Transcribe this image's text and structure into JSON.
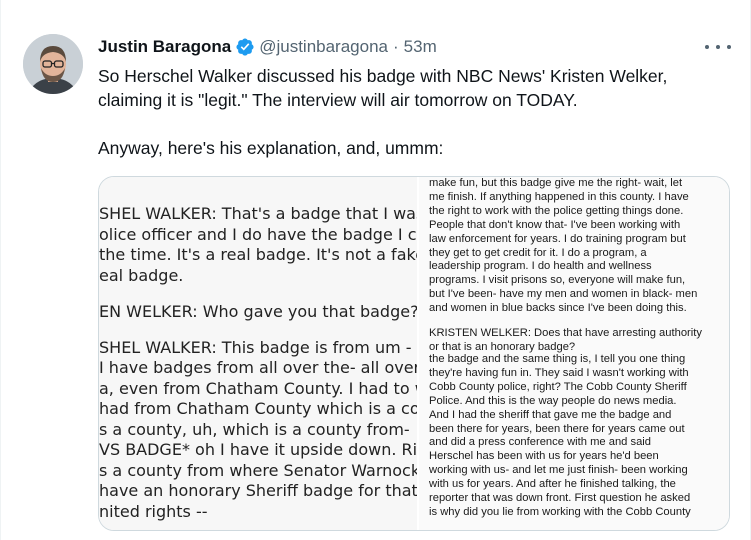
{
  "author": {
    "display_name": "Justin Baragona",
    "handle": "@justinbaragona",
    "separator": "·",
    "time": "53m"
  },
  "tweet": {
    "paragraph1": "So Herschel Walker discussed his badge with NBC News' Kristen Welker, claiming it is \"legit.\" The interview will air tomorrow on TODAY.",
    "paragraph2": "Anyway, here's his explanation, and, ummm:"
  },
  "media": {
    "left_transcript": [
      "SHEL WALKER: That's a badge that I was g",
      "olice officer and I do have the badge I carr",
      "the time. It's a real badge. It's not a fake b",
      "eal badge.",
      "EN WELKER: Who gave you that badge?",
      "SHEL WALKER: This badge is from um - th",
      "I have badges from all over the- all over",
      "a, even from Chatham County. I had to wa",
      "had from Chatham County which is a cou",
      "s a county, uh, which is a county from-",
      "VS BADGE* oh I have it upside down. Righ",
      "s a county from where Senator Warnock",
      "have an honorary Sheriff badge for that c",
      "nited rights --"
    ],
    "right_top": [
      "make fun, but this badge give me the right- wait, let",
      "me finish. If anything happened in this county. I have",
      "the right to work with the police getting things done.",
      "People that don't know that- I've been working with",
      "law enforcement for years. I do training program but",
      "they get to get credit for it. I do a program, a",
      "leadership program. I do health and wellness",
      "programs. I visit prisons so, everyone will make fun,",
      "but I've been- have my men and women in black- men",
      "and women in blue backs since I've been doing this."
    ],
    "right_question": [
      "KRISTEN WELKER: Does that have arresting authority",
      "or that is an honorary badge?"
    ],
    "right_bottom": [
      "the badge and the same thing is, I tell you one thing",
      "they're having fun in. They said I wasn't working with",
      "Cobb County police, right? The Cobb County Sheriff",
      "Police. And this is the way people do news media.",
      "And I had the sheriff that gave me the badge and",
      "been there for years, been there for years came out",
      "and did a press conference with me and said",
      "Herschel has been with us for years he'd been",
      "working with us- and let me just finish- been working",
      "with us for years. And after he finished talking, the",
      "reporter that was down front. First question he asked",
      "is why did you lie from working with the Cobb County"
    ]
  },
  "colors": {
    "verified": "#1d9bf0",
    "text": "#0f1419",
    "secondary": "#536471",
    "border": "#cfd9de"
  }
}
